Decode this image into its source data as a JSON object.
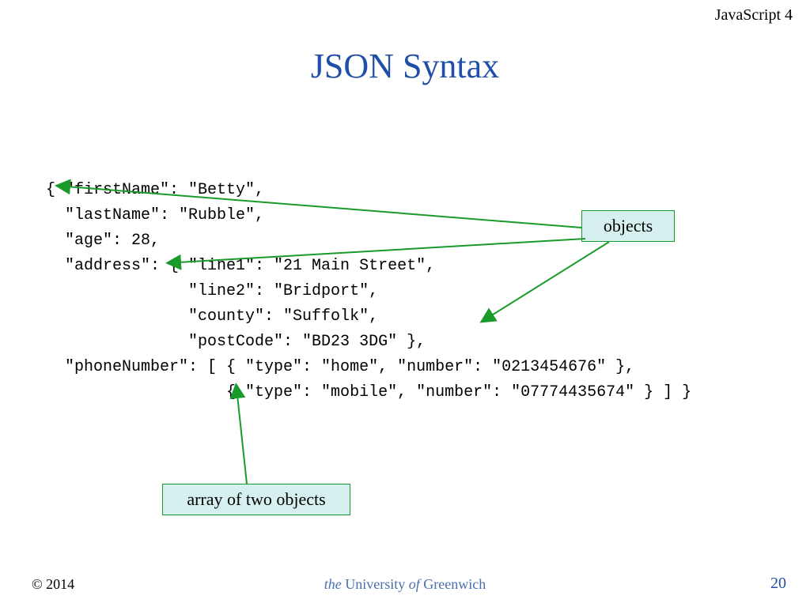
{
  "header": {
    "topic": "JavaScript 4"
  },
  "title": "JSON Syntax",
  "code": {
    "lines": [
      "{ \"firstName\": \"Betty\",",
      "  \"lastName\": \"Rubble\",",
      "  \"age\": 28,",
      "  \"address\": { \"line1\": \"21 Main Street\",",
      "               \"line2\": \"Bridport\",",
      "               \"county\": \"Suffolk\",",
      "               \"postCode\": \"BD23 3DG\" },",
      "  \"phoneNumber\": [ { \"type\": \"home\", \"number\": \"0213454676\" },",
      "                   { \"type\": \"mobile\", \"number\": \"07774435674\" } ] }"
    ]
  },
  "callouts": {
    "objects": "objects",
    "array": "array of two objects"
  },
  "footer": {
    "copyright": "© 2014",
    "center_the": "the",
    "center_uni": " University ",
    "center_of": "of",
    "center_gre": " Greenwich",
    "page": "20"
  },
  "json_example": {
    "firstName": "Betty",
    "lastName": "Rubble",
    "age": 28,
    "address": {
      "line1": "21 Main Street",
      "line2": "Bridport",
      "county": "Suffolk",
      "postCode": "BD23 3DG"
    },
    "phoneNumber": [
      {
        "type": "home",
        "number": "0213454676"
      },
      {
        "type": "mobile",
        "number": "07774435674"
      }
    ]
  }
}
